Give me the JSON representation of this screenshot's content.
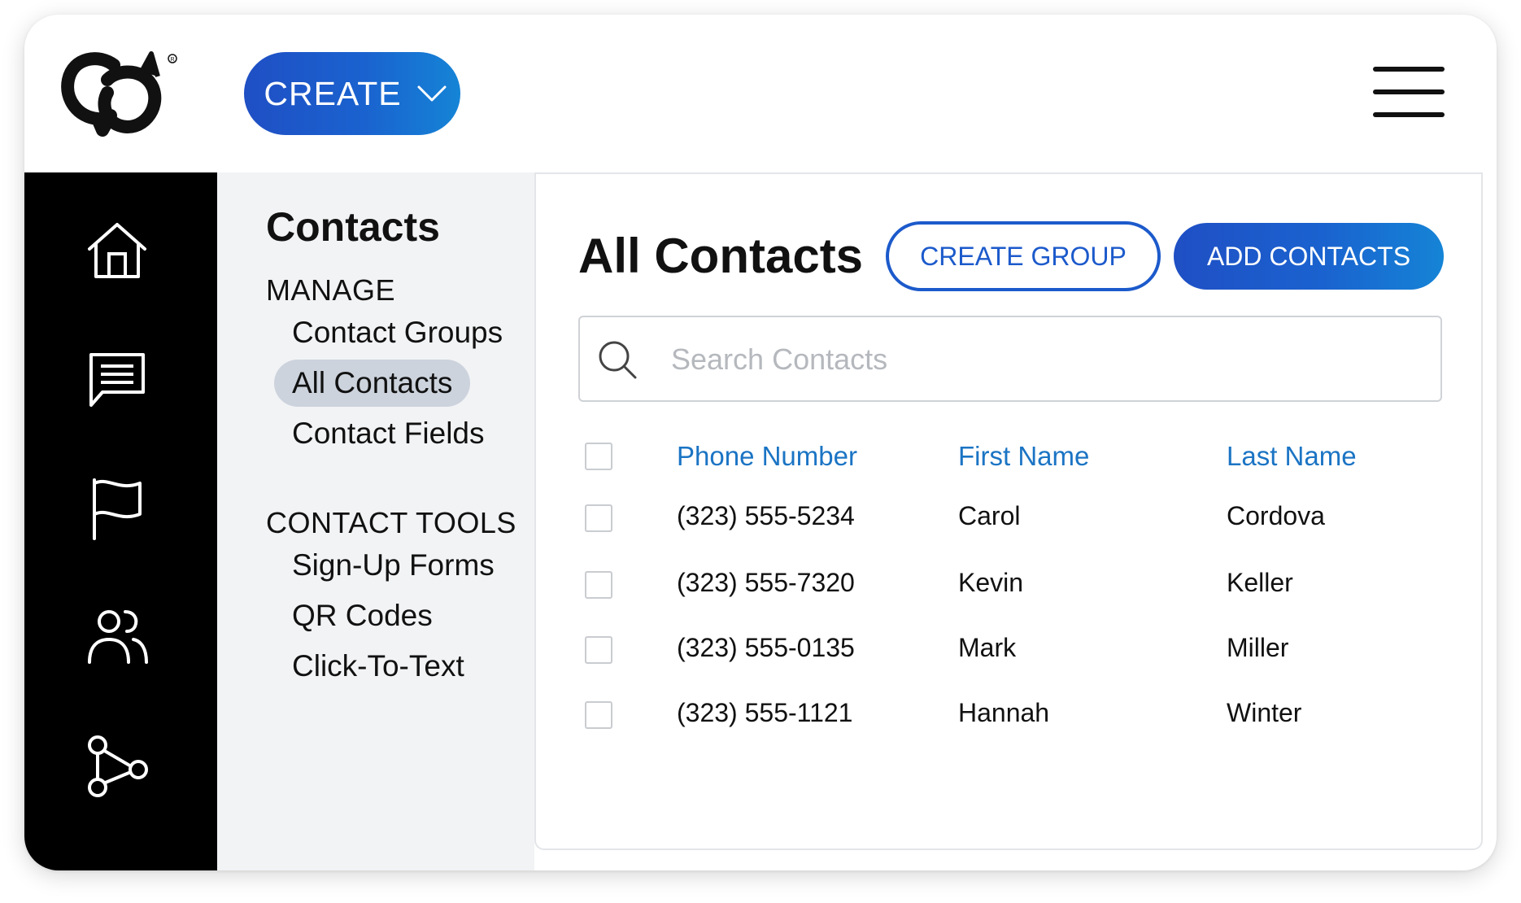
{
  "header": {
    "create_label": "CREATE",
    "logo_icon": "brand-logo-icon",
    "menu_icon": "hamburger-menu-icon"
  },
  "rail": {
    "icons": [
      "home-icon",
      "message-icon",
      "flag-icon",
      "contacts-icon",
      "integrations-icon"
    ]
  },
  "subnav": {
    "title": "Contacts",
    "manage_heading": "MANAGE",
    "manage_items": [
      "Contact Groups",
      "All Contacts",
      "Contact Fields"
    ],
    "active_item": "All Contacts",
    "tools_heading": "CONTACT TOOLS",
    "tools_items": [
      "Sign-Up Forms",
      "QR Codes",
      "Click-To-Text"
    ]
  },
  "main": {
    "title": "All Contacts",
    "create_group_label": "CREATE GROUP",
    "add_contacts_label": "ADD CONTACTS",
    "search_placeholder": "Search Contacts",
    "columns": [
      "Phone Number",
      "First Name",
      "Last Name"
    ],
    "rows": [
      {
        "phone": "(323) 555-5234",
        "first": "Carol",
        "last": "Cordova"
      },
      {
        "phone": "(323) 555-7320",
        "first": "Kevin",
        "last": "Keller"
      },
      {
        "phone": "(323) 555-0135",
        "first": "Mark",
        "last": "Miller"
      },
      {
        "phone": "(323) 555-1121",
        "first": "Hannah",
        "last": "Winter"
      }
    ]
  },
  "colors": {
    "accent": "#1c5acb",
    "header_link": "#1b74c4",
    "rail": "#000000",
    "subnav_bg": "#f2f3f5",
    "active_pill": "#ccd3dd"
  }
}
